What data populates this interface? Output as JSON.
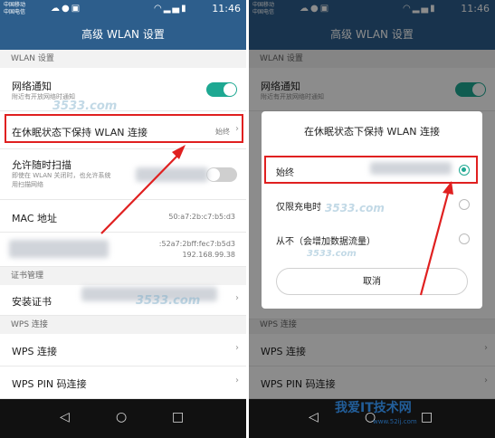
{
  "left_screen": {
    "status_bar": {
      "carrier_1": "中国移动",
      "carrier_2": "中国电信",
      "time": "11:46"
    },
    "app_title": "高级 WLAN 设置",
    "section_wlan": "WLAN 设置",
    "network_notify": {
      "title": "网络通知",
      "subtitle": "附近有开放网络时通知",
      "enabled": true
    },
    "sleep_keep": {
      "title": "在休眠状态下保持 WLAN 连接",
      "value": "始终"
    },
    "scan_allowed": {
      "title": "允许随时扫描",
      "subtitle_1": "即使在 WLAN 关闭时，也允许系统",
      "subtitle_2": "用扫描网络",
      "enabled": false
    },
    "mac": {
      "title": "MAC 地址",
      "value": "50:a7:2b:c7:b5:d3"
    },
    "ip": {
      "value_1": ":52a7:2bff:fec7:b5d3",
      "value_2": "192.168.99.38"
    },
    "section_cert": "证书管理",
    "install_cert": "安装证书",
    "section_wps": "WPS 连接",
    "wps_connect": "WPS 连接",
    "wps_pin": "WPS PIN 码连接",
    "watermark": "3533.com"
  },
  "right_screen": {
    "status_bar": {
      "carrier_1": "中国移动",
      "carrier_2": "中国电信",
      "time": "11:46"
    },
    "app_title": "高级 WLAN 设置",
    "section_wlan": "WLAN 设置",
    "network_notify": {
      "title": "网络通知",
      "subtitle": "附近有开放网络时通知"
    },
    "dialog": {
      "title": "在休眠状态下保持 WLAN 连接",
      "options": [
        "始终",
        "仅限充电时",
        "从不（会增加数据流量）"
      ],
      "selected_index": 0,
      "cancel": "取消"
    },
    "section_wps": "WPS 连接",
    "wps_connect": "WPS 连接",
    "wps_pin": "WPS PIN 码连接",
    "watermark": "3533.com"
  },
  "brand_watermark": {
    "name": "我爱IT技术网",
    "url": "www.52ij.com"
  },
  "colors": {
    "accent": "#1ea892",
    "appbar": "#2d5e8c",
    "highlight": "#e02020"
  }
}
